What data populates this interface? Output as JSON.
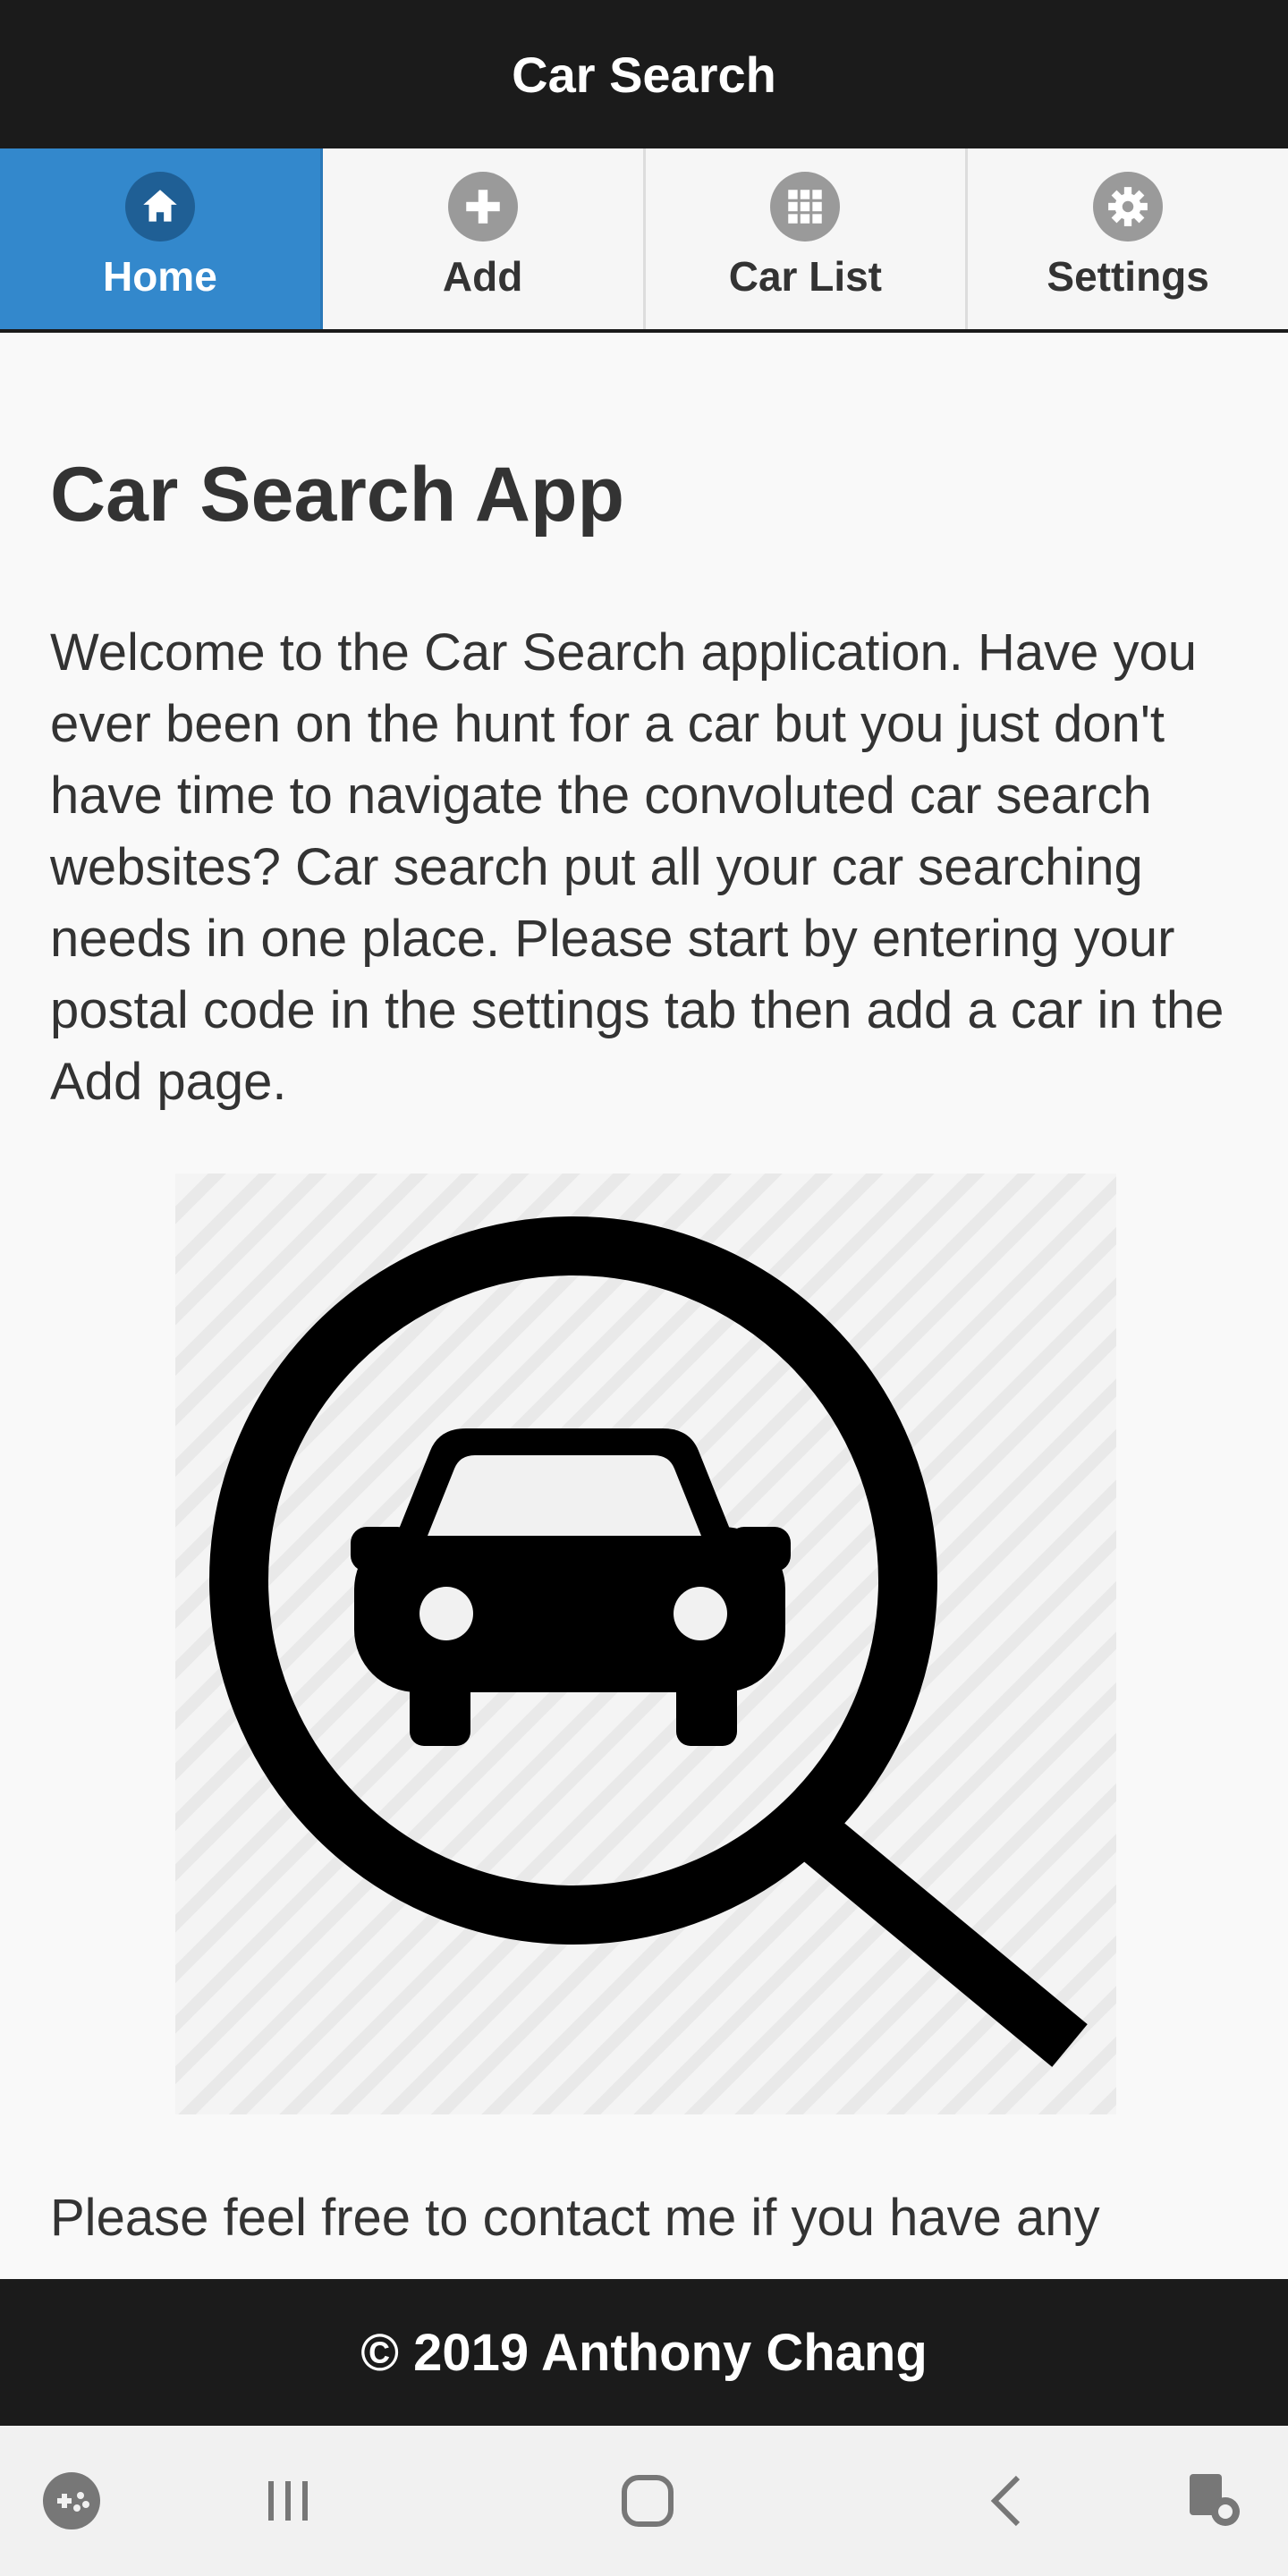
{
  "header": {
    "title": "Car Search"
  },
  "nav": {
    "tabs": [
      {
        "label": "Home",
        "icon": "home-icon",
        "active": true
      },
      {
        "label": "Add",
        "icon": "plus-icon",
        "active": false
      },
      {
        "label": "Car List",
        "icon": "grid-icon",
        "active": false
      },
      {
        "label": "Settings",
        "icon": "gear-icon",
        "active": false
      }
    ]
  },
  "main": {
    "title": "Car Search App",
    "intro": "Welcome to the Car Search application. Have you ever been on the hunt for a car but you just don't have time to navigate the convoluted car search websites? Car search put all your car searching needs in one place. Please start by entering your postal code in the settings tab then add a car in the Add page.",
    "hero_icon": "car-search-magnifier-icon",
    "contact": "Please feel free to contact me if you have any"
  },
  "footer": {
    "text": "© 2019 Anthony Chang"
  },
  "system_bar": {
    "icons": [
      "game-launcher-icon",
      "recent-apps-icon",
      "home-button-icon",
      "back-icon",
      "assistant-touch-icon"
    ]
  },
  "colors": {
    "header_bg": "#1b1b1b",
    "active_tab": "#3388cc",
    "text": "#333333"
  }
}
